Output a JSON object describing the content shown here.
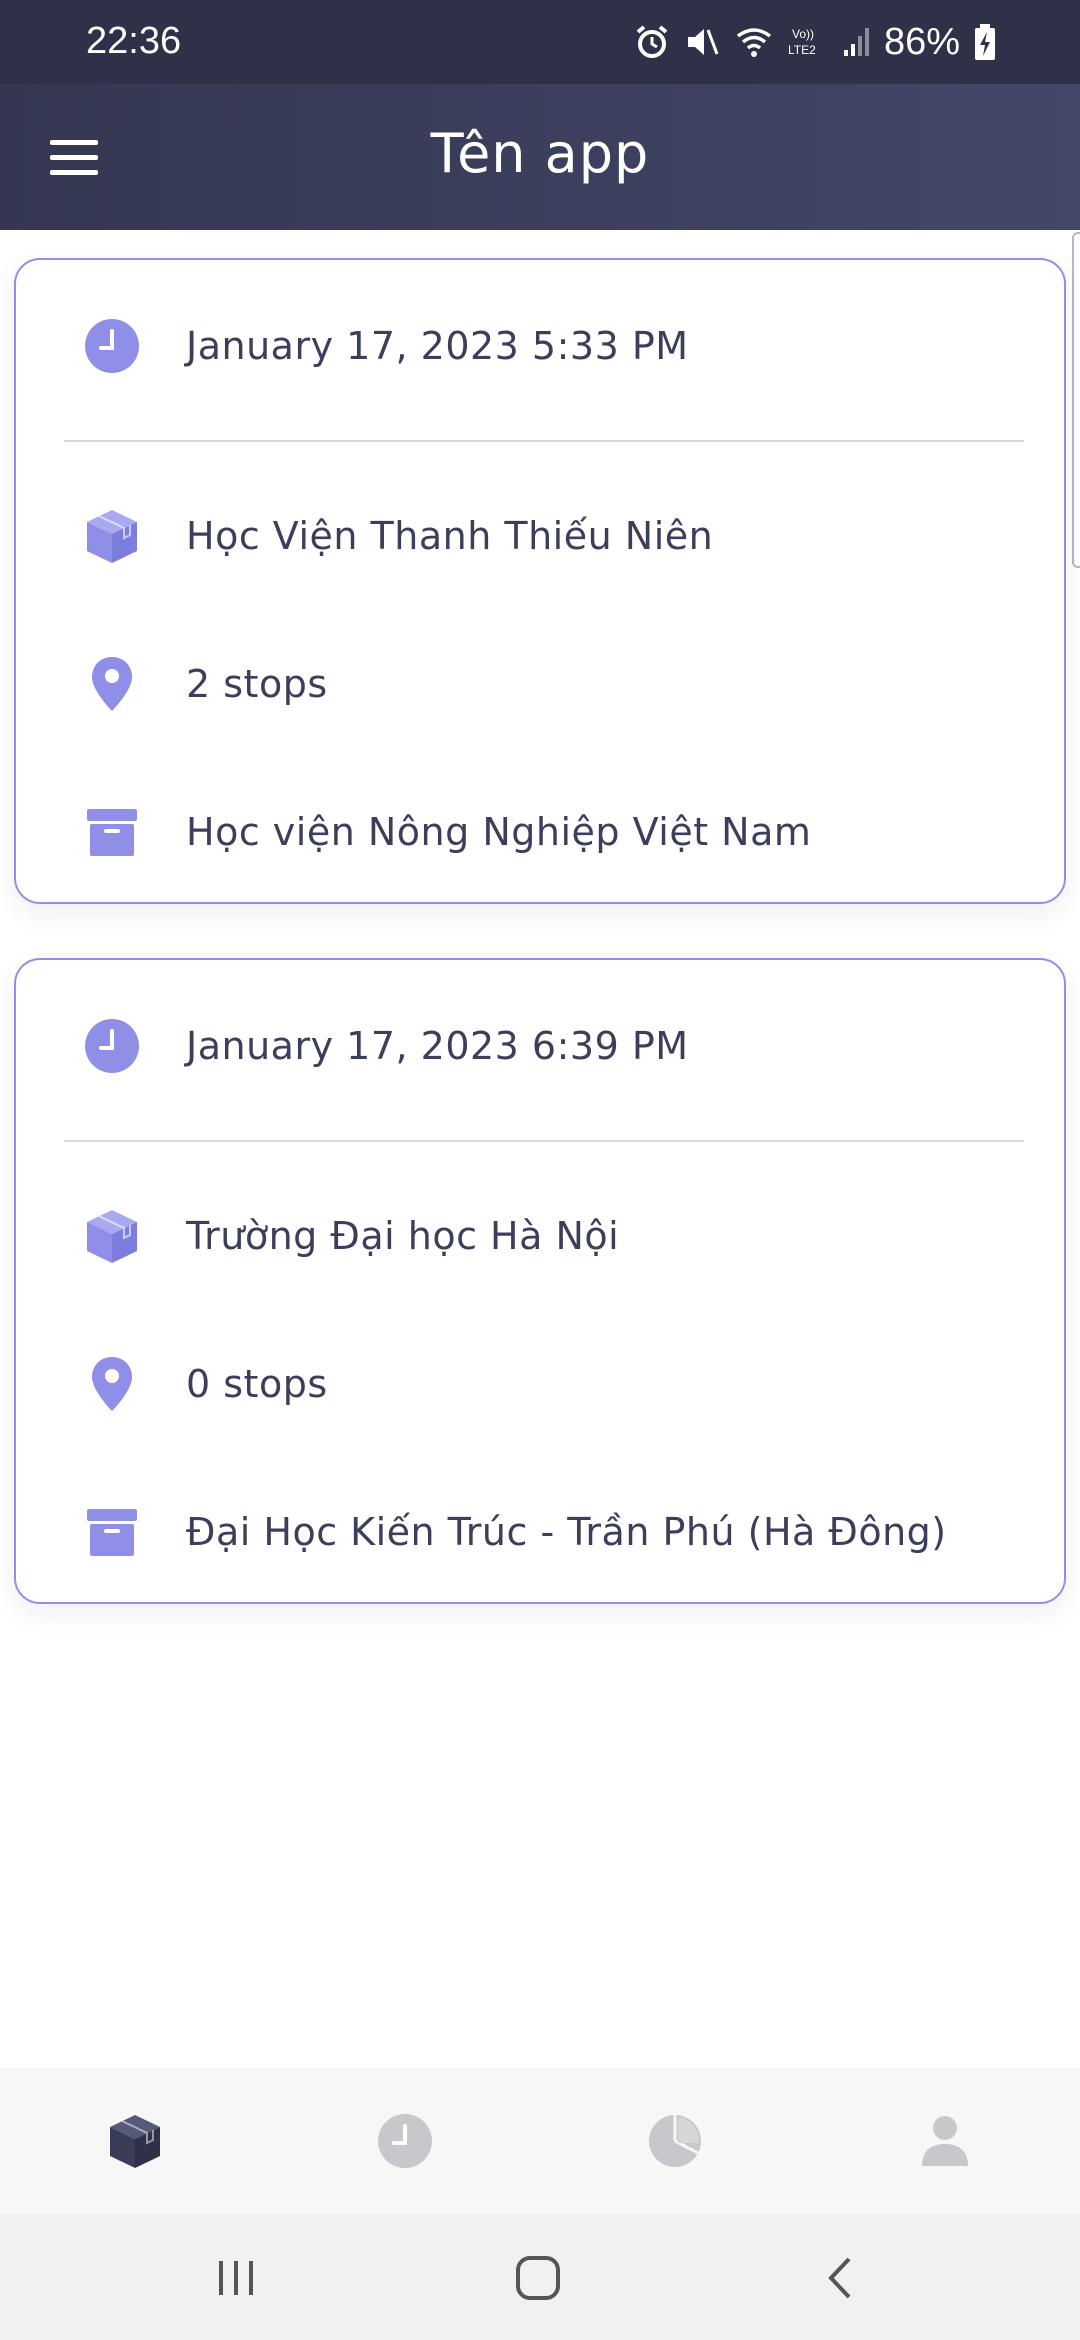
{
  "status_bar": {
    "time": "22:36",
    "battery": "86%"
  },
  "app_bar": {
    "title": "Tên app"
  },
  "colors": {
    "accent": "#8f8fe8",
    "header": "#3a3d58",
    "nav_active": "#3a3d58",
    "nav_inactive": "#c8c8cc"
  },
  "trips": [
    {
      "datetime": "January 17, 2023 5:33 PM",
      "pickup": "Học Viện Thanh Thiếu Niên",
      "stops": "2 stops",
      "dropoff": "Học viện Nông Nghiệp Việt Nam"
    },
    {
      "datetime": "January 17, 2023 6:39 PM",
      "pickup": "Trường Đại học Hà Nội",
      "stops": "0 stops",
      "dropoff": "Đại Học Kiến Trúc - Trần Phú (Hà Đông)"
    }
  ],
  "bottom_nav": [
    {
      "icon": "package-icon",
      "active": true
    },
    {
      "icon": "clock-icon",
      "active": false
    },
    {
      "icon": "pie-chart-icon",
      "active": false
    },
    {
      "icon": "person-icon",
      "active": false
    }
  ],
  "system_nav": [
    "recent-apps-icon",
    "home-icon",
    "back-icon"
  ]
}
